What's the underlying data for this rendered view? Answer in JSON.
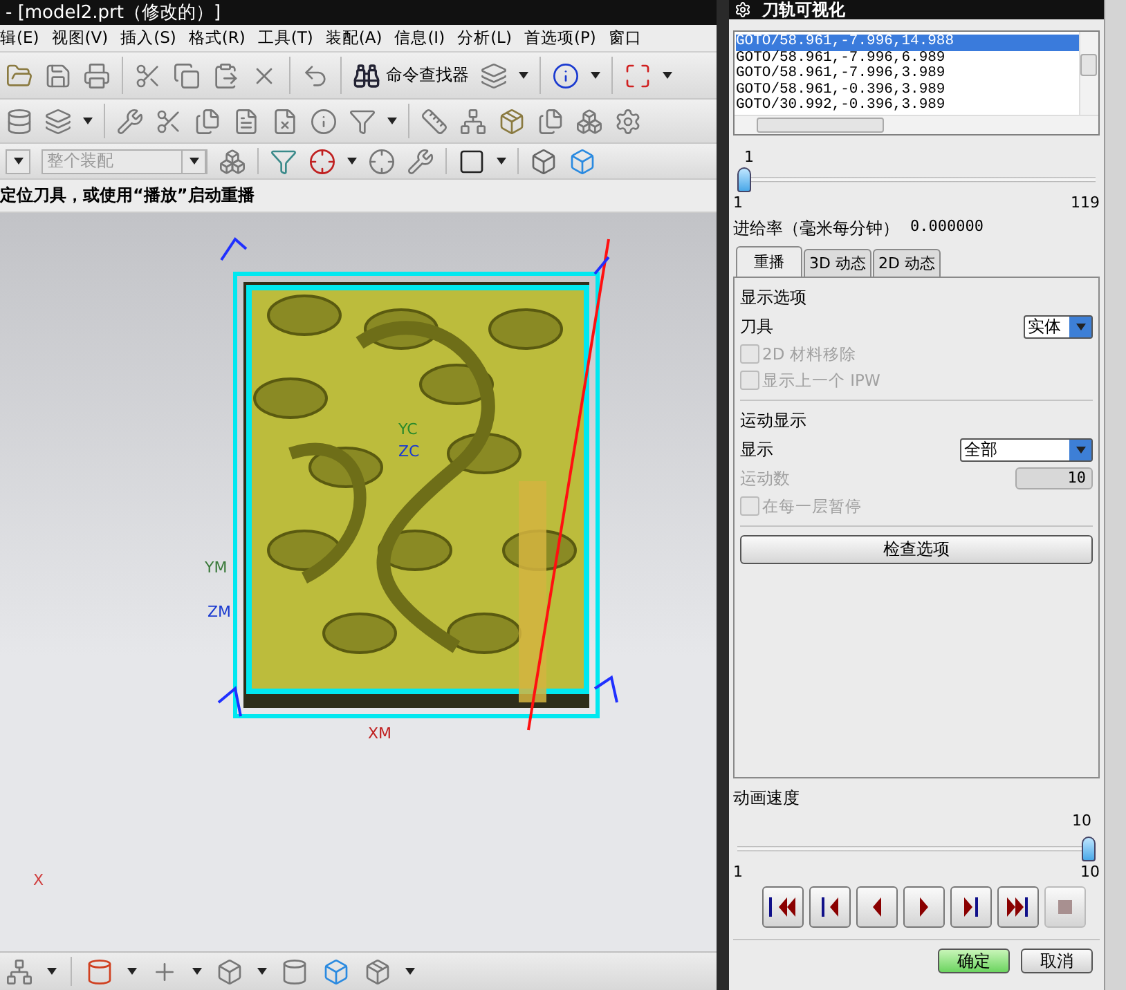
{
  "window": {
    "title": "- [model2.prt（修改的）]"
  },
  "menu": [
    "辑(E)",
    "视图(V)",
    "插入(S)",
    "格式(R)",
    "工具(T)",
    "装配(A)",
    "信息(I)",
    "分析(L)",
    "首选项(P)",
    "窗口"
  ],
  "toolbar": {
    "command_finder": "命令查找器",
    "assembly_filter": "整个装配"
  },
  "hint": "定位刀具，或使用“播放”启动重播",
  "viewport": {
    "axis_labels": [
      "YC",
      "ZC",
      "YM",
      "ZM",
      "XM",
      "X"
    ]
  },
  "dialog": {
    "title": "刀轨可视化",
    "path_list": [
      {
        "text": "GOTO/58.961,-7.996,14.988",
        "selected": true
      },
      {
        "text": "GOTO/58.961,-7.996,6.989",
        "selected": false
      },
      {
        "text": "GOTO/58.961,-7.996,3.989",
        "selected": false
      },
      {
        "text": "GOTO/58.961,-0.396,3.989",
        "selected": false
      },
      {
        "text": "GOTO/30.992,-0.396,3.989",
        "selected": false
      }
    ],
    "position_slider": {
      "value": "1",
      "min": "1",
      "max": "119",
      "level": 0
    },
    "feed_rate": {
      "label": "进给率（毫米每分钟）",
      "value": "0.000000"
    },
    "tabs": [
      {
        "label": "重播",
        "selected": true
      },
      {
        "label": "3D 动态",
        "selected": false
      },
      {
        "label": "2D 动态",
        "selected": false
      }
    ],
    "display_options": {
      "heading": "显示选项",
      "tool_label": "刀具",
      "tool_value": "实体",
      "checkboxes": [
        {
          "label": "2D 材料移除",
          "checked": false,
          "disabled": true
        },
        {
          "label": "显示上一个 IPW",
          "checked": false,
          "disabled": true
        }
      ]
    },
    "motion_display": {
      "heading": "运动显示",
      "display_label": "显示",
      "display_value": "全部",
      "count_label": "运动数",
      "count_value": "10",
      "count_disabled": true,
      "checkboxes": [
        {
          "label": "在每一层暂停",
          "checked": false,
          "disabled": true
        }
      ],
      "check_button": "检查选项"
    },
    "speed_slider": {
      "label": "动画速度",
      "value": "10",
      "min": "1",
      "max": "10",
      "level": 1
    },
    "playback": [
      {
        "kind": "to-start",
        "disabled": false
      },
      {
        "kind": "step-back",
        "disabled": false
      },
      {
        "kind": "reverse",
        "disabled": false
      },
      {
        "kind": "play",
        "disabled": false
      },
      {
        "kind": "step-forward",
        "disabled": false
      },
      {
        "kind": "to-end",
        "disabled": false
      },
      {
        "kind": "stop",
        "disabled": true
      }
    ],
    "buttons": [
      {
        "label": "确定",
        "default": true
      },
      {
        "label": "取消",
        "default": false
      }
    ]
  }
}
